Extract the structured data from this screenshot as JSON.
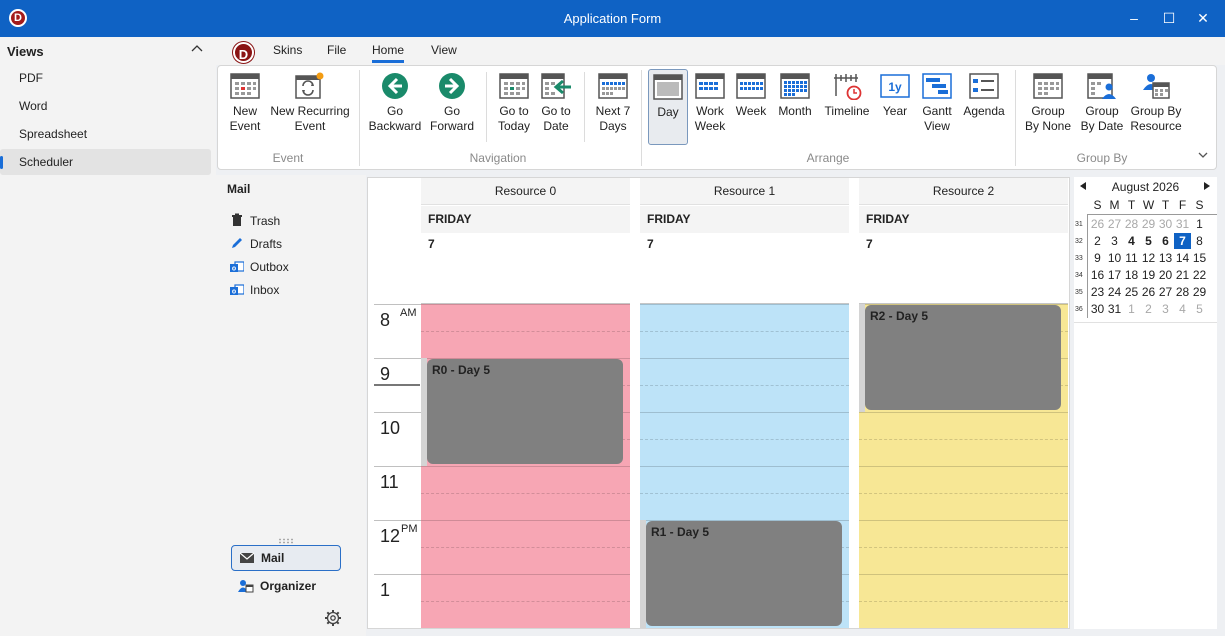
{
  "window": {
    "title": "Application Form",
    "logo_letter": "D",
    "minimize": "–",
    "maximize": "☐",
    "close": "✕"
  },
  "views": {
    "header": "Views",
    "items": [
      {
        "label": "PDF"
      },
      {
        "label": "Word"
      },
      {
        "label": "Spreadsheet"
      },
      {
        "label": "Scheduler",
        "active": true
      }
    ]
  },
  "ribbon": {
    "logo_letter": "D",
    "tabs": [
      "Skins",
      "File",
      "Home",
      "View"
    ],
    "active_tab": "Home",
    "groups": {
      "event": "Event",
      "navigation": "Navigation",
      "arrange": "Arrange",
      "group_by": "Group By"
    },
    "buttons": {
      "new_event": [
        "New",
        "Event"
      ],
      "new_recurring": [
        "New Recurring",
        "Event"
      ],
      "go_backward": [
        "Go",
        "Backward"
      ],
      "go_forward": [
        "Go",
        "Forward"
      ],
      "go_today": [
        "Go to",
        "Today"
      ],
      "go_date": [
        "Go to",
        "Date"
      ],
      "next7": [
        "Next 7",
        "Days"
      ],
      "day": [
        "Day"
      ],
      "work_week": [
        "Work",
        "Week"
      ],
      "week": [
        "Week"
      ],
      "month": [
        "Month"
      ],
      "timeline": [
        "Timeline"
      ],
      "year": [
        "Year"
      ],
      "gantt": [
        "Gantt",
        "View"
      ],
      "agenda": [
        "Agenda"
      ],
      "group_none": [
        "Group",
        "By None"
      ],
      "group_date": [
        "Group",
        "By Date"
      ],
      "group_resource": [
        "Group By",
        "Resource"
      ]
    },
    "year_icon_text": "1y",
    "accent": "#1a6ed8",
    "nav_green": "#1a8a6a"
  },
  "mail": {
    "header": "Mail",
    "folders": [
      {
        "label": "Trash",
        "icon": "trash-icon"
      },
      {
        "label": "Drafts",
        "icon": "pencil-icon"
      },
      {
        "label": "Outbox",
        "icon": "outbox-icon"
      },
      {
        "label": "Inbox",
        "icon": "inbox-icon"
      }
    ],
    "nav": [
      {
        "label": "Mail",
        "active": true
      },
      {
        "label": "Organizer"
      }
    ]
  },
  "scheduler": {
    "resources": [
      {
        "name": "Resource 0",
        "day": "FRIDAY",
        "date": "7",
        "color": "#f7a6b4"
      },
      {
        "name": "Resource 1",
        "day": "FRIDAY",
        "date": "7",
        "color": "#bde3f8"
      },
      {
        "name": "Resource 2",
        "day": "FRIDAY",
        "date": "7",
        "color": "#f7e795"
      }
    ],
    "hours": [
      {
        "hour": "8",
        "ampm": "AM"
      },
      {
        "hour": "9",
        "ampm": ""
      },
      {
        "hour": "10",
        "ampm": ""
      },
      {
        "hour": "11",
        "ampm": ""
      },
      {
        "hour": "12",
        "ampm": "PM"
      },
      {
        "hour": "1",
        "ampm": ""
      }
    ],
    "appointments": [
      {
        "resource": 0,
        "title": "R0 - Day 5",
        "start": 9,
        "end": 11
      },
      {
        "resource": 1,
        "title": "R1 - Day 5",
        "start": 12,
        "end": 14
      },
      {
        "resource": 2,
        "title": "R2 - Day 5",
        "start": 8,
        "end": 10
      }
    ],
    "inactive_until": {
      "0": 8,
      "1": 12,
      "2": 10
    },
    "appt_color": "#808080"
  },
  "calendar": {
    "month_label": "August 2026",
    "dow": [
      "S",
      "M",
      "T",
      "W",
      "T",
      "F",
      "S"
    ],
    "weeks": [
      {
        "wk": "31",
        "days": [
          "26",
          "27",
          "28",
          "29",
          "30",
          "31",
          "1"
        ]
      },
      {
        "wk": "32",
        "days": [
          "2",
          "3",
          "4",
          "5",
          "6",
          "7",
          "8"
        ]
      },
      {
        "wk": "33",
        "days": [
          "9",
          "10",
          "11",
          "12",
          "13",
          "14",
          "15"
        ]
      },
      {
        "wk": "34",
        "days": [
          "16",
          "17",
          "18",
          "19",
          "20",
          "21",
          "22"
        ]
      },
      {
        "wk": "35",
        "days": [
          "23",
          "24",
          "25",
          "26",
          "27",
          "28",
          "29"
        ]
      },
      {
        "wk": "36",
        "days": [
          "30",
          "31",
          "1",
          "2",
          "3",
          "4",
          "5"
        ]
      }
    ],
    "today": "7",
    "today_color": "#0f62c4"
  }
}
